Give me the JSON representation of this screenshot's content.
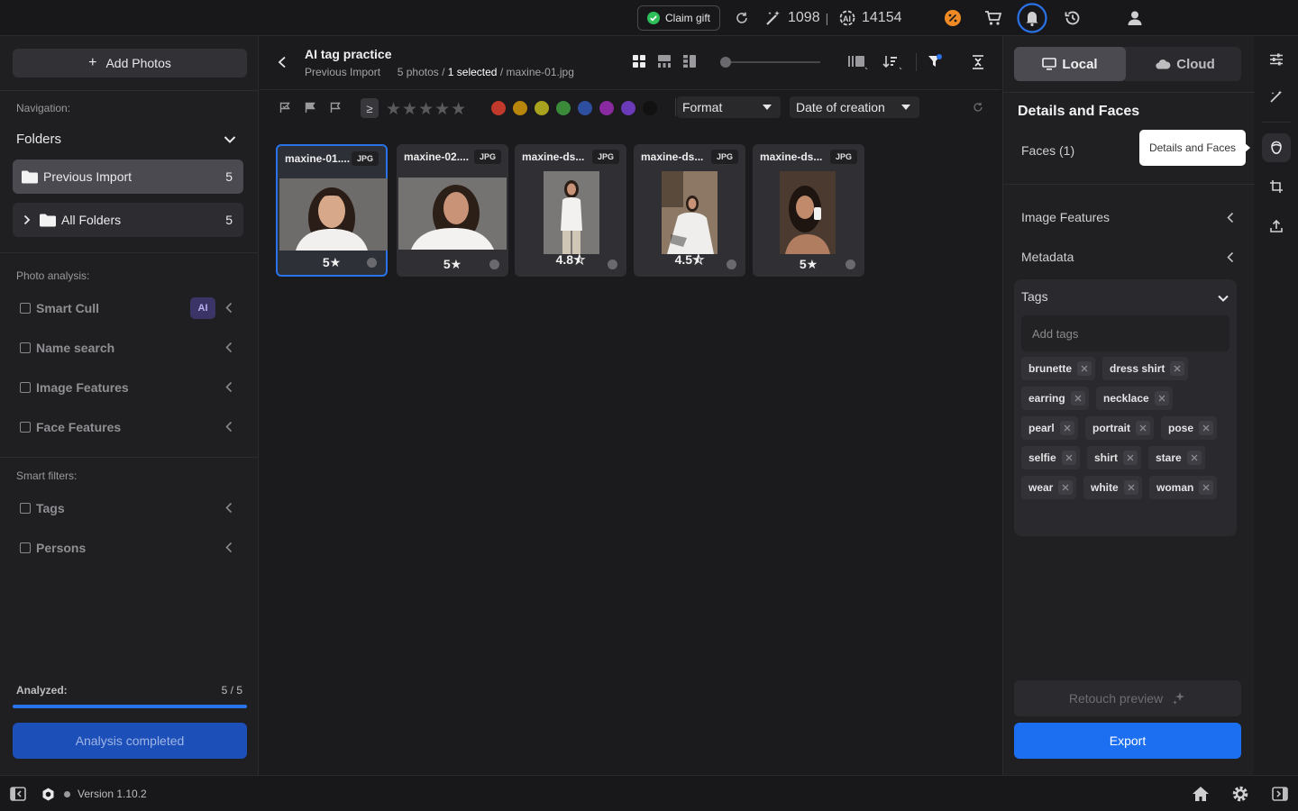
{
  "topbar": {
    "claim_gift": "Claim gift",
    "credits": "1098",
    "separator": "|",
    "ai_credits": "14154"
  },
  "sidebar": {
    "add_photos": "Add Photos",
    "navigation_label": "Navigation:",
    "folders_label": "Folders",
    "folders": [
      {
        "label": "Previous Import",
        "count": "5"
      },
      {
        "label": "All Folders",
        "count": "5"
      }
    ],
    "analysis_label": "Photo analysis:",
    "analysis_items": [
      {
        "label": "Smart Cull",
        "badge": "AI"
      },
      {
        "label": "Name search"
      },
      {
        "label": "Image Features"
      },
      {
        "label": "Face Features"
      }
    ],
    "smart_filters_label": "Smart filters:",
    "smart_filters": [
      {
        "label": "Tags"
      },
      {
        "label": "Persons"
      }
    ],
    "analyzed_label": "Analyzed:",
    "analyzed_value": "5 / 5",
    "analyzed_progress": 1.0,
    "analysis_button": "Analysis completed"
  },
  "main": {
    "title": "AI tag practice",
    "breadcrumb_folder": "Previous Import",
    "photos_count": "5 photos /",
    "selected": "1 selected",
    "selected_file": "/ maxine-01.jpg",
    "filter_gte": "≥",
    "format_dropdown": "Format",
    "date_dropdown": "Date of creation",
    "color_labels": [
      "#c0392b",
      "#b8860b",
      "#a8a21e",
      "#3a8a3a",
      "#2e4fa0",
      "#8a2aa0",
      "#6a3ab8",
      "#111111"
    ],
    "photos": [
      {
        "name": "maxine-01....",
        "format": "JPG",
        "rating": "5",
        "star": "★",
        "selected": true
      },
      {
        "name": "maxine-02....",
        "format": "JPG",
        "rating": "5",
        "star": "★",
        "selected": false
      },
      {
        "name": "maxine-ds...",
        "format": "JPG",
        "rating": "4.8",
        "star": "⯪",
        "selected": false
      },
      {
        "name": "maxine-ds...",
        "format": "JPG",
        "rating": "4.5",
        "star": "⯪",
        "selected": false
      },
      {
        "name": "maxine-ds...",
        "format": "JPG",
        "rating": "5",
        "star": "★",
        "selected": false
      }
    ]
  },
  "right_panel": {
    "local_tab": "Local",
    "cloud_tab": "Cloud",
    "heading": "Details and Faces",
    "faces": "Faces (1)",
    "tooltip": "Details and Faces",
    "image_features": "Image Features",
    "metadata": "Metadata",
    "tags_label": "Tags",
    "add_tags_placeholder": "Add tags",
    "tags": [
      "brunette",
      "dress shirt",
      "earring",
      "necklace",
      "pearl",
      "portrait",
      "pose",
      "selfie",
      "shirt",
      "stare",
      "wear",
      "white",
      "woman"
    ],
    "retouch_preview": "Retouch preview",
    "export": "Export"
  },
  "bottom": {
    "version": "Version 1.10.2"
  }
}
